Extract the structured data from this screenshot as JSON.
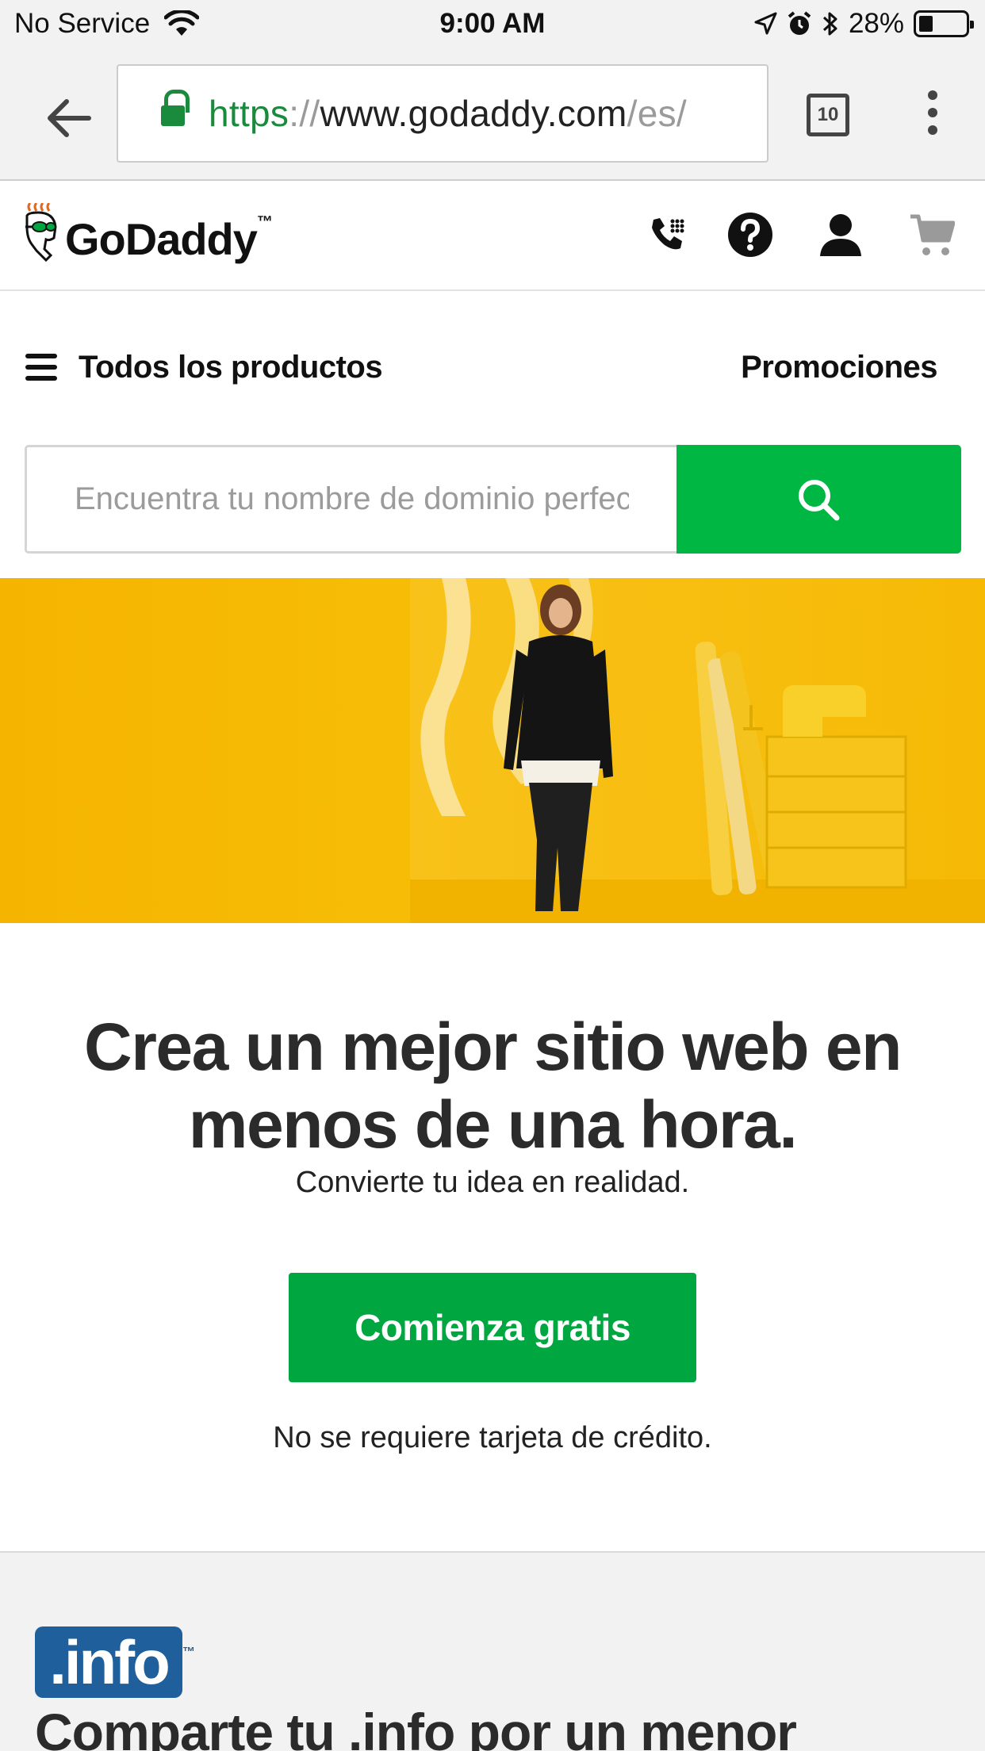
{
  "status_bar": {
    "carrier": "No Service",
    "time": "9:00 AM",
    "battery": "28%"
  },
  "browser": {
    "url_scheme": "https",
    "url_sep": "://",
    "url_host": "www.godaddy.com",
    "url_path": "/es/",
    "tab_count": "10"
  },
  "header": {
    "logo_text": "GoDaddy",
    "logo_tm": "™"
  },
  "nav": {
    "products": "Todos los productos",
    "promotions": "Promociones"
  },
  "search": {
    "placeholder": "Encuentra tu nombre de dominio perfecto"
  },
  "promo": {
    "title_line1": "Crea un mejor sitio web en",
    "title_line2": "menos de una hora.",
    "subtitle": "Convierte tu idea en realidad.",
    "cta": "Comienza gratis",
    "note": "No se requiere tarjeta de crédito."
  },
  "info_section": {
    "logo": ".info",
    "title": "Comparte tu .info por un menor"
  },
  "colors": {
    "brand_green": "#00a63f",
    "search_green": "#00b744",
    "hero_yellow": "#f6b800",
    "url_green": "#1a8a3c",
    "info_blue": "#1e5f9c"
  }
}
